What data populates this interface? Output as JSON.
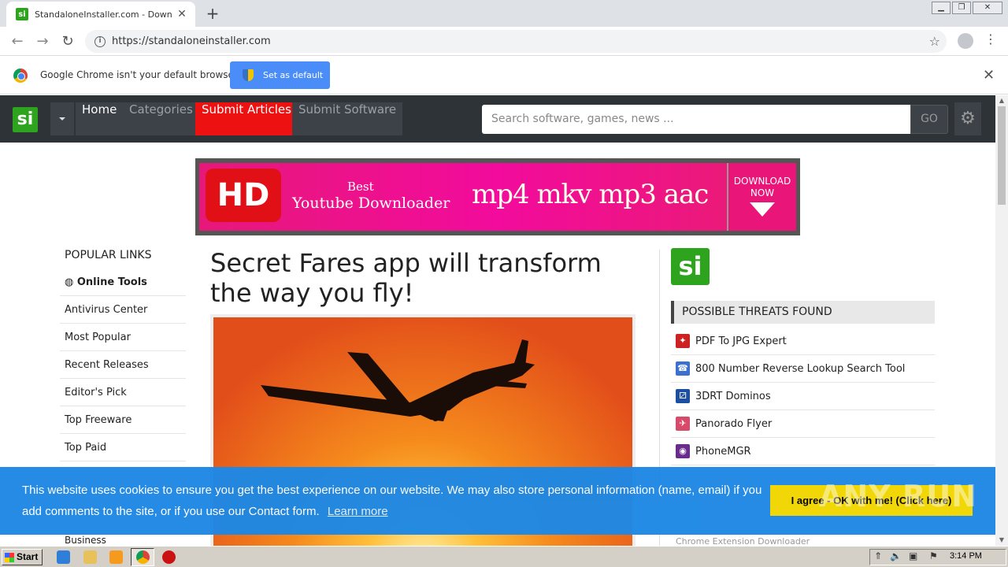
{
  "browser": {
    "tab_title": "StandaloneInstaller.com - Download",
    "tab_favicon": "si",
    "url": "https://standaloneinstaller.com",
    "infobar_message": "Google Chrome isn't your default browser",
    "set_default_label": "Set as default"
  },
  "site": {
    "logo": "si",
    "nav": [
      {
        "label": "Home"
      },
      {
        "label": "Categories"
      },
      {
        "label": "Submit Articles"
      },
      {
        "label": "Submit Software"
      }
    ],
    "search_placeholder": "Search software, games, news ...",
    "go_label": "GO"
  },
  "banner": {
    "hd": "HD",
    "best": "Best",
    "title": "Youtube Downloader",
    "formats": "mp4 mkv mp3 aac",
    "cta_line1": "DOWNLOAD",
    "cta_line2": "NOW"
  },
  "sidebar": {
    "title": "POPULAR LINKS",
    "links": [
      {
        "label": "Online Tools",
        "icon": "globe-icon"
      },
      {
        "label": "Antivirus Center"
      },
      {
        "label": "Most Popular"
      },
      {
        "label": "Recent Releases"
      },
      {
        "label": "Editor's Pick"
      },
      {
        "label": "Top Freeware"
      },
      {
        "label": "Top Paid"
      }
    ],
    "business": "Business"
  },
  "article": {
    "title": "Secret Fares app will transform the way you fly!"
  },
  "threats": {
    "logo": "si",
    "title": "POSSIBLE THREATS FOUND",
    "items": [
      {
        "label": "PDF To JPG Expert",
        "color": "#cc2222"
      },
      {
        "label": "800 Number Reverse Lookup Search Tool",
        "color": "#3b6fd1"
      },
      {
        "label": "3DRT Dominos",
        "color": "#1c4fa0"
      },
      {
        "label": "Panorado Flyer",
        "color": "#d84a6a"
      },
      {
        "label": "PhoneMGR",
        "color": "#6a2c8c"
      }
    ],
    "partial_item": "Chrome Extension Downloader"
  },
  "cookie": {
    "text": "This website uses cookies to ensure you get the best experience on our website. We may also store personal information (name, email) if you add comments to the site, or if you use our Contact form.",
    "learn_more": "Learn more",
    "agree": "I agree - OK with me! (Click here)",
    "watermark": "ANY RUN"
  },
  "taskbar": {
    "start": "Start",
    "time": "3:14 PM"
  }
}
